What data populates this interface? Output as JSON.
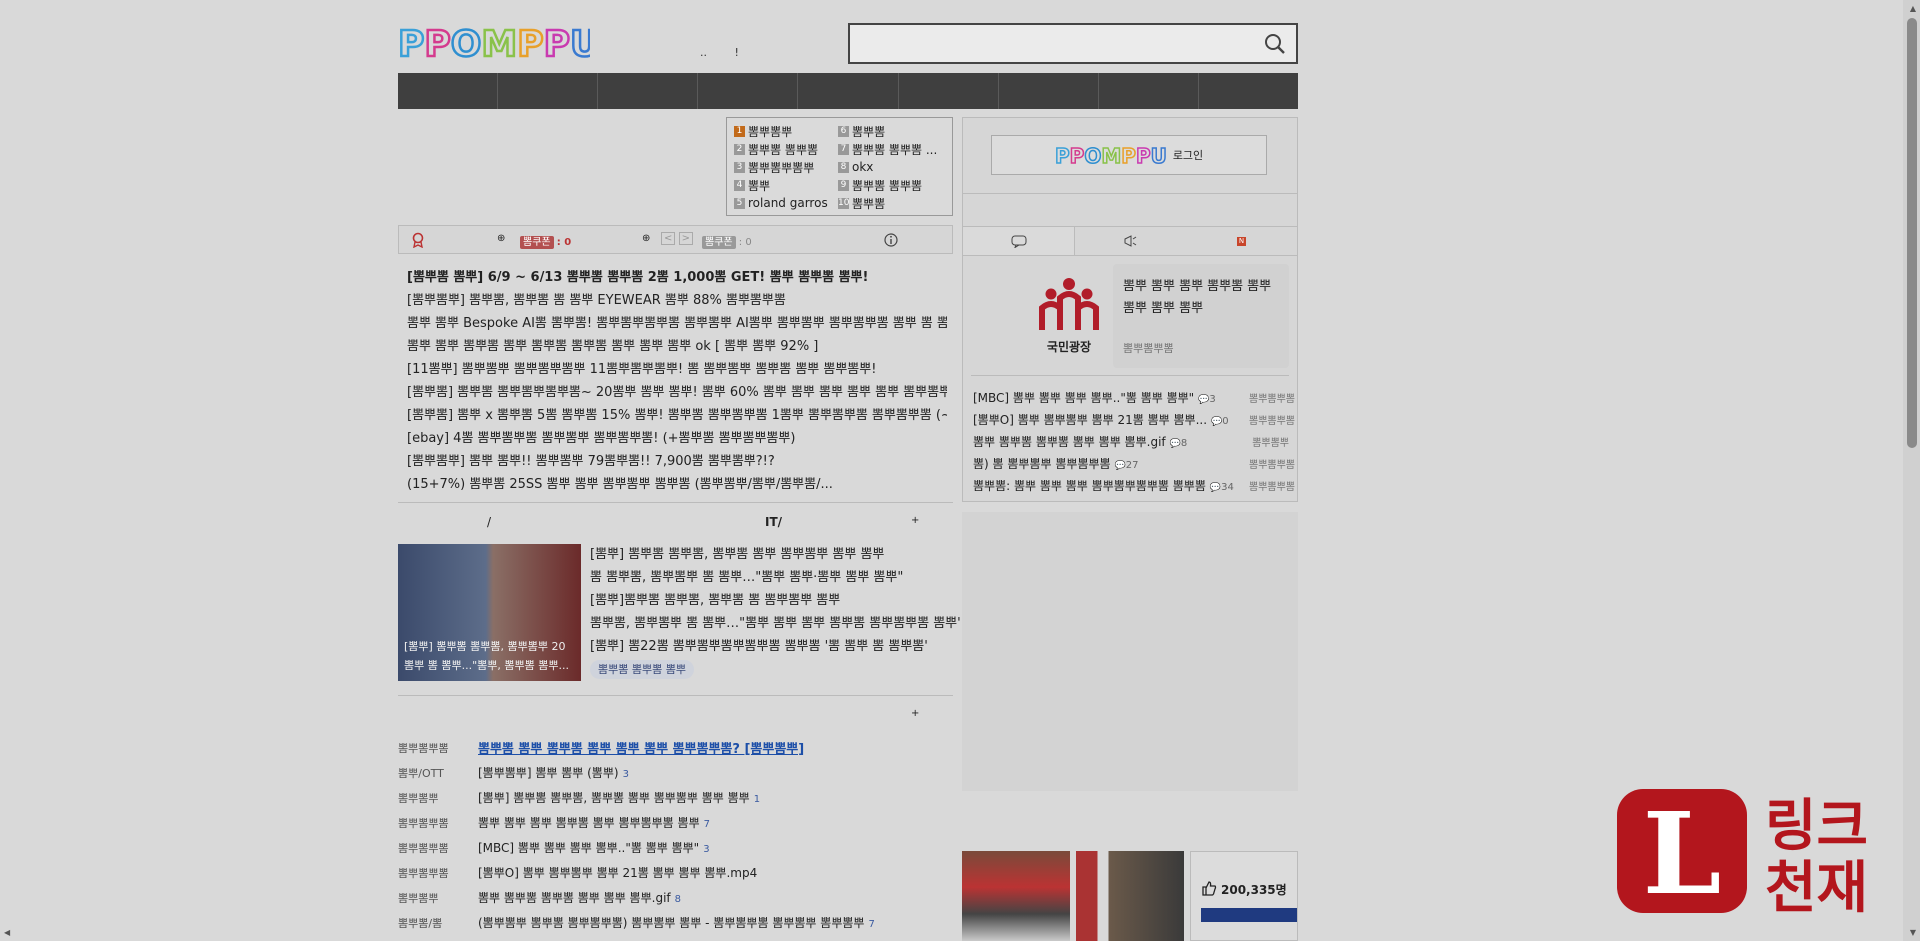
{
  "header": {
    "logo_text": "PPOMPPU",
    "mini_links": [
      "..",
      "!"
    ],
    "search_placeholder": ""
  },
  "ranking": [
    {
      "num": "1",
      "label": "뽐뿌뽐뿌"
    },
    {
      "num": "6",
      "label": "뽐뿌뽐"
    },
    {
      "num": "2",
      "label": "뽐뿌뽐 뽐뿌뽐"
    },
    {
      "num": "7",
      "label": "뽐뿌뽐 뽐뿌뽐 ..."
    },
    {
      "num": "3",
      "label": "뽐뿌뽐뿌뽐뿌"
    },
    {
      "num": "8",
      "label": "okx"
    },
    {
      "num": "4",
      "label": "뽐뿌"
    },
    {
      "num": "9",
      "label": "뽐뿌뽐 뽐뿌뽐"
    },
    {
      "num": "5",
      "label": "roland garros"
    },
    {
      "num": "10",
      "label": "뽐뿌뽐"
    }
  ],
  "coupon_bar": {
    "coupon_tag": "뽐쿠폰",
    "coupon_count": ": 0",
    "coupon_tag2": "뽐쿠폰",
    "coupon_count2": ": 0",
    "page_prev": "<",
    "page_next": ">"
  },
  "hot_list": [
    "[뽐뿌뽐 뽐뿌] 6/9 ~ 6/13 뽐뿌뽐 뽐뿌뽐 2뽐 1,000뽐 GET! 뽐뿌 뽐뿌뽐 뽐뿌!",
    "[뽐뿌뽐뿌] 뽐뿌뽐, 뽐뿌뽐 뽐 뽐뿌 EYEWEAR 뽐뿌 88% 뽐뿌뽐뿌뽐",
    "뽐뿌 뽐뿌 Bespoke AI뽐 뽐뿌뽐! 뽐뿌뽐뿌뽐뿌뽐 뽐뿌뽐뿌 AI뽐뿌 뽐뿌뽐뿌 뽐뿌뽐뿌뽐 뽐뿌 뽐 뽐!",
    "뽐뿌 뽐뿌 뽐뿌뽐 뽐뿌 뽐뿌뽐 뽐뿌뽐 뽐뿌 뽐뿌 뽐뿌 ok [ 뽐뿌 뽐뿌 92% ]",
    "[11뽐뿌] 뽐뿌뽐뿌 뽐뿌뽐뿌뽐뿌 11뽐뿌뽐뿌뽐뿌! 뽐 뽐뿌뽐뿌 뽐뿌뽐 뽐뿌 뽐뿌뽐뿌!",
    "[뽐뿌뽐] 뽐뿌뽐 뽐뿌뽐뿌뽐뿌뽐~ 20뽐뿌 뽐뿌 뽐뿌! 뽐뿌 60% 뽐뿌 뽐뿌 뽐뿌 뽐뿌 뽐뿌 뽐뿌뽐뿌 (~5/20)",
    "[뽐뿌뽐] 뽐뿌 x 뽐뿌뽐 5뽐 뽐뿌뽐 15% 뽐뿌! 뽐뿌뽐 뽐뿌뽐뿌뽐 1뽐뿌 뽐뿌뽐뿌뽐 뽐뿌뽐뿌뽐 (~5/31)",
    "[ebay] 4뽐 뽐뿌뽐뿌뽐 뽐뿌뽐뿌 뽐뿌뽐뿌뽐! (+뽐뿌뽐 뽐뿌뽐뿌뽐뿌)",
    "[뽐뿌뽐뿌] 뽐뿌 뽐뿌!! 뽐뿌뽐뿌 79뽐뿌뽐!! 7,900뽐 뽐뿌뽐뿌?!?",
    "(15+7%) 뽐뿌뽐 25SS 뽐뿌 뽐뿌 뽐뿌뽐뿌 뽐뿌뽐 (뽐뿌뽐뿌/뽐뿌/뽐뿌뽐/..."
  ],
  "section_tabs": {
    "tab1": "/",
    "tab2": "IT/",
    "more": "+"
  },
  "news": {
    "image_caption": "[뽐뿌] 뽐뿌뽐 뽐뿌뽐, 뽐뿌뽐뿌 20뽐뿌 뽐 뽐뿌...\"뽐뿌, 뽐뿌뽐 뽐뿌...",
    "items": [
      "[뽐뿌] 뽐뿌뽐 뽐뿌뽐, 뽐뿌뽐 뽐뿌 뽐뿌뽐뿌 뽐뿌 뽐뿌",
      "뽐 뽐뿌뽐, 뽐뿌뽐뿌 뽐 뽐뿌…\"뽐뿌 뽐뿌·뽐뿌 뽐뿌 뽐뿌\"",
      "[뽐뿌]뽐뿌뽐 뽐뿌뽐, 뽐뿌뽐 뽐 뽐뿌뽐뿌 뽐뿌",
      "뽐뿌뽐, 뽐뿌뽐뿌 뽐 뽐뿌…\"뽐뿌 뽐뿌 뽐뿌 뽐뿌뽐 뽐뿌뽐뿌뽐 뽐뿌\"",
      "[뽐뿌] 뽐22뽐 뽐뿌뽐뿌뽐뿌뽐뿌뽐 뽐뿌뽐 '뽐 뽐뿌 뽐 뽐뿌뽐'"
    ],
    "more_label": "뽐뿌뽐 뽐뿌뽐 뽐뿌"
  },
  "board": {
    "more": "+",
    "rows": [
      {
        "cat": "뽐뿌뽐뿌뽐",
        "title": "뽐뿌뽐 뽐뿌 뽐뿌뽐 뽐뿌 뽐뿌 뽐뿌 뽐뿌뽐뿌뽐? [뽐뿌뽐뿌]",
        "count": ""
      },
      {
        "cat": "뽐뿌/OTT",
        "title": "[뽐뿌뽐뿌] 뽐뿌 뽐뿌 (뽐뿌)",
        "count": "3"
      },
      {
        "cat": "뽐뿌뽐뿌",
        "title": "[뽐뿌] 뽐뿌뽐 뽐뿌뽐, 뽐뿌뽐 뽐뿌 뽐뿌뽐뿌 뽐뿌 뽐뿌",
        "count": "1"
      },
      {
        "cat": "뽐뿌뽐뿌뽐",
        "title": "뽐뿌 뽐뿌 뽐뿌 뽐뿌뽐 뽐뿌 뽐뿌뽐뿌뽐 뽐뿌",
        "count": "7"
      },
      {
        "cat": "뽐뿌뽐뿌뽐",
        "title": "[MBC] 뽐뿌 뽐뿌 뽐뿌 뽐뿌..\"뽐 뽐뿌 뽐뿌\"",
        "count": "3"
      },
      {
        "cat": "뽐뿌뽐뿌뽐",
        "title": "[뽐뿌O] 뽐뿌 뽐뿌뽐뿌 뽐뿌 21뽐 뽐뿌 뽐뿌 뽐뿌.mp4",
        "count": ""
      },
      {
        "cat": "뽐뿌뽐뿌",
        "title": "뽐뿌 뽐뿌뽐 뽐뿌뽐 뽐뿌 뽐뿌 뽐뿌.gif",
        "count": "8"
      },
      {
        "cat": "뽐뿌뽐/뽐",
        "title": "(뽐뿌뽐뿌 뽐뿌뽐 뽐뿌뽐뿌뽐) 뽐뿌뽐뿌 뽐뿌 - 뽐뿌뽐뿌뽐 뽐뿌뽐뿌 뽐뿌뽐뿌",
        "count": "7"
      }
    ]
  },
  "right_panel": {
    "login_label": "로그인",
    "plaza_name": "국민광장",
    "plaza_text": "뽐뿌 뽐뿌 뽐뿌 뽐뿌뽐 뽐뿌 뽐뿌 뽐뿌 뽐뿌",
    "plaza_sub": "뽐뿌뽐뿌뽐",
    "rows": [
      {
        "title": "[MBC] 뽐뿌 뽐뿌 뽐뿌 뽐뿌..\"뽐 뽐뿌 뽐뿌\"",
        "count": "3",
        "date": "뽐뿌뽐뿌뽐"
      },
      {
        "title": "[뽐뿌O] 뽐뿌 뽐뿌뽐뿌 뽐뿌 21뽐 뽐뿌 뽐뿌...",
        "count": "0",
        "date": "뽐뿌뽐뿌뽐"
      },
      {
        "title": "뽐뿌 뽐뿌뽐 뽐뿌뽐 뽐뿌 뽐뿌 뽐뿌.gif",
        "count": "8",
        "date": "뽐뿌뽐뿌"
      },
      {
        "title": "뽐) 뽐 뽐뿌뽐뿌 뽐뿌뽐뿌뽐",
        "count": "27",
        "date": "뽐뿌뽐뿌뽐"
      },
      {
        "title": "뽐뿌뽐: 뽐뿌 뽐뿌 뽐뿌 뽐뿌뽐뿌뽐뿌뽐 뽐뿌뽐",
        "count": "34",
        "date": "뽐뿌뽐뿌뽐"
      }
    ]
  },
  "likes": {
    "count": "200,335명"
  },
  "watermark": {
    "letter": "L",
    "line1": "링크",
    "line2": "천재"
  }
}
